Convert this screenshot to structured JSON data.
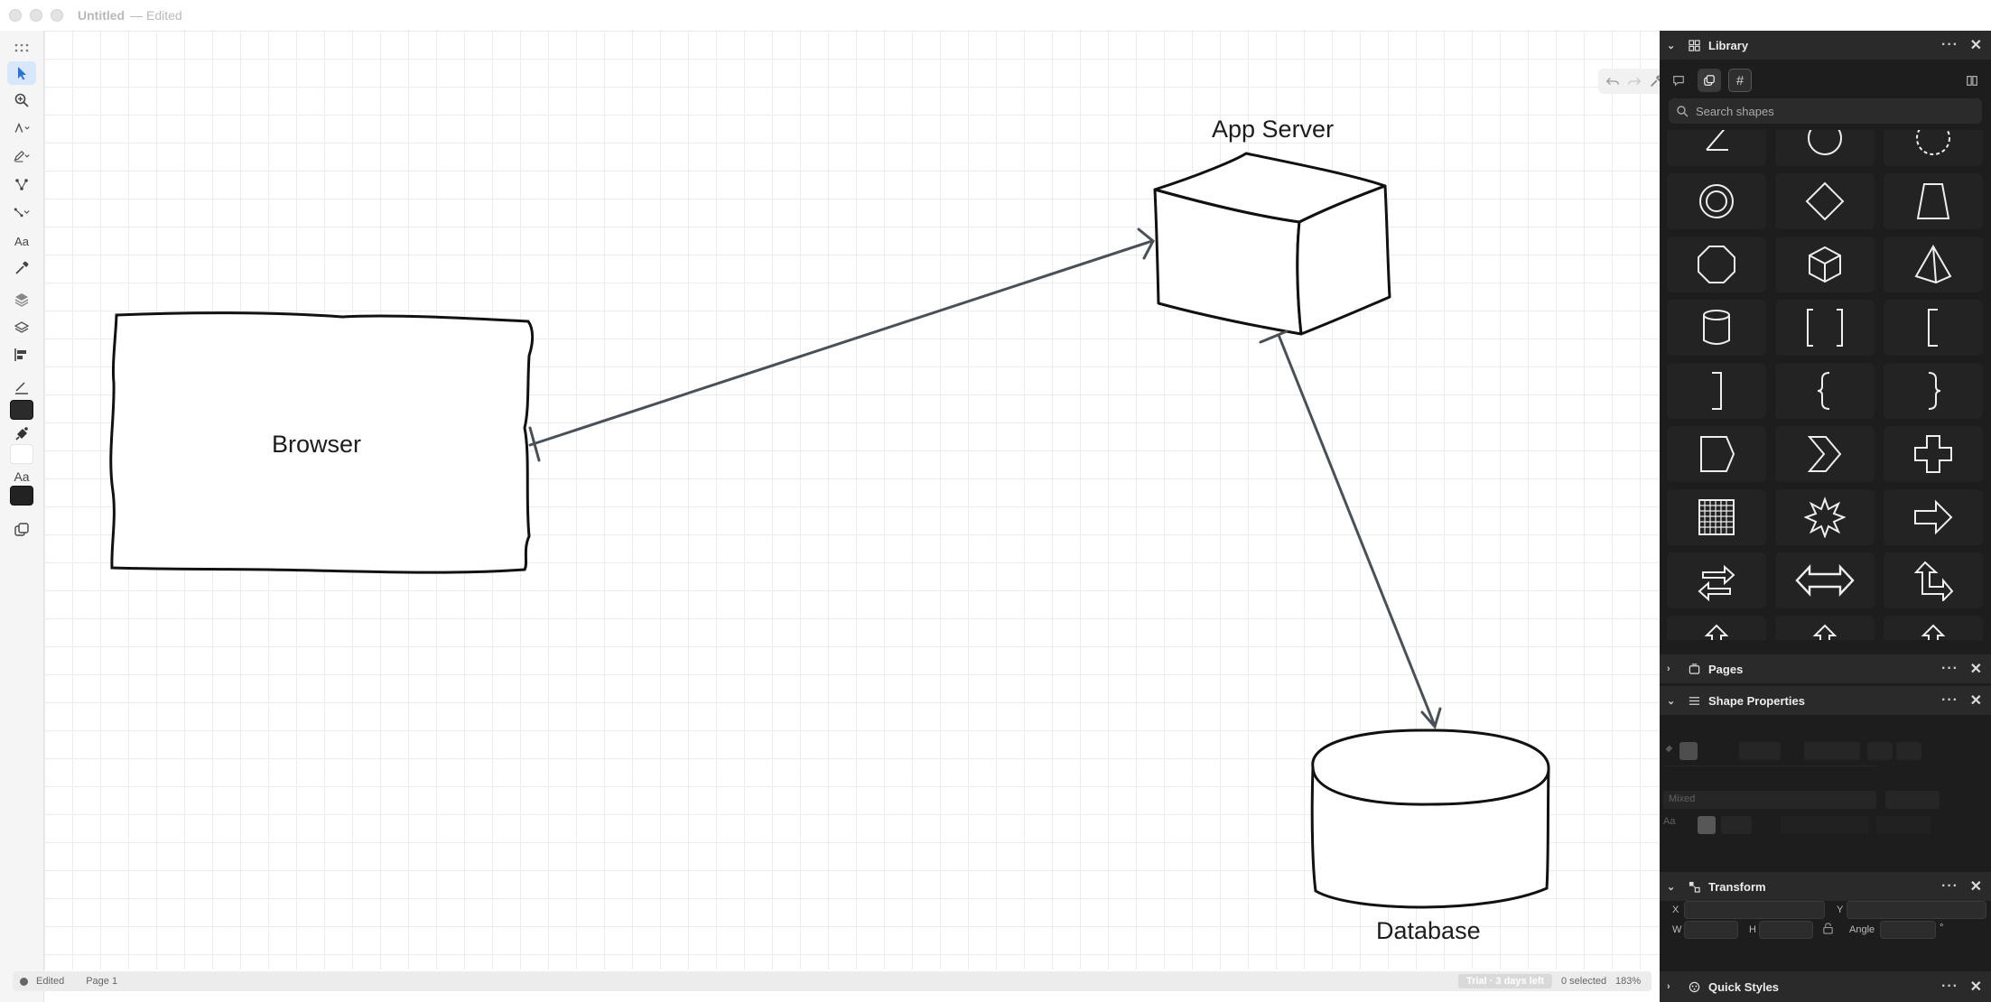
{
  "window": {
    "title": "Untitled",
    "subtitle": "— Edited"
  },
  "left_toolbar": {
    "tools": [
      "grip-icon",
      "pointer-icon",
      "zoom-icon",
      "pen-icon",
      "pencil-icon",
      "node-icon",
      "connector-icon",
      "text-icon",
      "eyedropper-icon",
      "layers-icon",
      "layer-stack-icon",
      "align-icon",
      "stroke-icon",
      "stroke-color-swatch",
      "fill-icon",
      "fill-color-swatch",
      "text-style-icon",
      "text-color-swatch",
      "duplicate-icon"
    ],
    "text_style_label": "Aa",
    "text_tool_label": "Aa",
    "stroke_color": "#2b2b2b",
    "fill_color": "#ffffff",
    "text_color": "#222222"
  },
  "canvas": {
    "shapes": [
      {
        "label": "Browser"
      },
      {
        "label": "App Server"
      },
      {
        "label": "Database"
      }
    ],
    "mini_toolbar": [
      "undo-icon",
      "redo-icon",
      "wrench-icon",
      "sidebar-icon"
    ]
  },
  "status_bar": {
    "state": "Edited",
    "page": "Page 1",
    "trial": "Trial · 3 days left",
    "selected": "0 selected",
    "zoom": "183%"
  },
  "right_panel": {
    "library": {
      "title": "Library",
      "search_placeholder": "Search shapes",
      "tabs": [
        "comment-icon",
        "copy-icon",
        "hash-icon",
        "book-icon"
      ],
      "shapes": [
        "triangle-shape",
        "circle-shape",
        "dashed-circle-shape",
        "ring-shape",
        "diamond-shape",
        "trapezoid-shape",
        "octagon-shape",
        "cube-shape",
        "pyramid-shape",
        "cylinder-shape",
        "brackets-shape",
        "left-bracket-shape",
        "right-bracket-shape",
        "left-brace-shape",
        "right-brace-shape",
        "pentagon-shape",
        "chevron-shape",
        "cross-shape",
        "grid-shape",
        "starburst-shape",
        "arrow-right-shape",
        "swap-arrows-shape",
        "double-arrow-shape",
        "bent-arrow-shape"
      ]
    },
    "pages": {
      "title": "Pages"
    },
    "shape_properties": {
      "title": "Shape Properties",
      "font_value": "Mixed",
      "text_label": "Aa"
    },
    "transform": {
      "title": "Transform",
      "x_label": "X",
      "y_label": "Y",
      "w_label": "W",
      "h_label": "H",
      "angle_label": "Angle",
      "angle_unit": "°"
    },
    "quick_styles": {
      "title": "Quick Styles"
    }
  },
  "colors": {
    "accent": "#2f6fd6",
    "panel_bg": "#1d1d1d",
    "connector": "#4a5058"
  }
}
